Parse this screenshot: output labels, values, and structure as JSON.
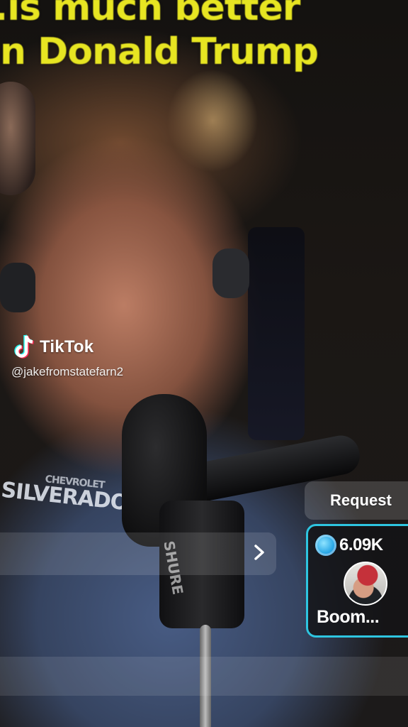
{
  "caption": {
    "line1": "...is much better",
    "line2": "n Donald Trump"
  },
  "watermark": {
    "brand": "TikTok",
    "handle": "@jakefromstatefarn2",
    "icon": "tiktok-logo-icon"
  },
  "banner": {
    "arrow_icon": "chevron-right-icon"
  },
  "request_button": {
    "label": "Request"
  },
  "rank_card": {
    "coin_icon": "coin-icon",
    "coins": "6.09K",
    "name": "Boom...",
    "accent_color": "#2ec5e0"
  },
  "scene_text": {
    "hoodie_small": "CHEVROLET",
    "hoodie_big": "SILVERADO",
    "mic_brand": "SHURE"
  },
  "colors": {
    "caption": "#e7e522",
    "card_border": "#2ec5e0"
  }
}
